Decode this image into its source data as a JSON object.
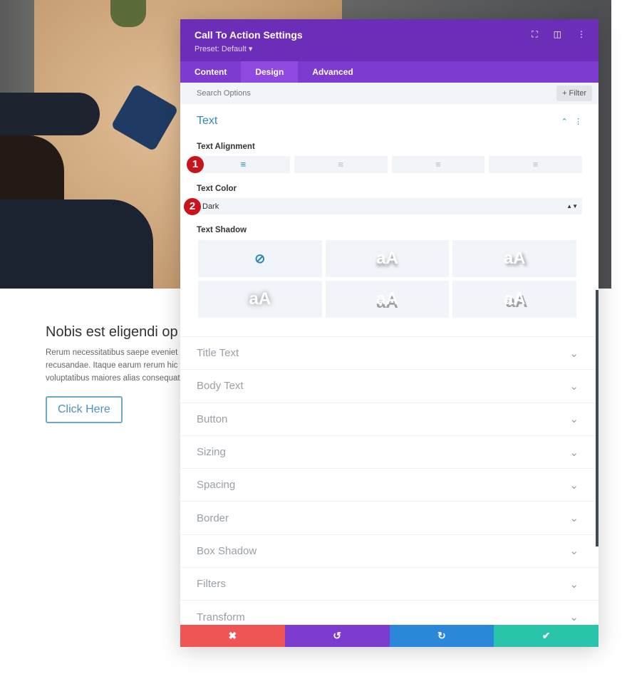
{
  "page": {
    "heading": "Nobis est eligendi op",
    "body_lines": [
      "Rerum necessitatibus saepe eveniet u",
      "recusandae. Itaque earum rerum hic t",
      "voluptatibus maiores alias consequatu"
    ],
    "button": "Click Here"
  },
  "panel": {
    "title": "Call To Action Settings",
    "preset": "Preset: Default ▾",
    "tabs": [
      "Content",
      "Design",
      "Advanced"
    ],
    "active_tab": "Design",
    "search_placeholder": "Search Options",
    "filter": "+ Filter",
    "section": {
      "title": "Text",
      "alignment_label": "Text Alignment",
      "color_label": "Text Color",
      "color_value": "Dark",
      "shadow_label": "Text Shadow",
      "shadow_preview": "aA"
    },
    "badges": [
      "1",
      "2"
    ],
    "groups": [
      "Title Text",
      "Body Text",
      "Button",
      "Sizing",
      "Spacing",
      "Border",
      "Box Shadow",
      "Filters",
      "Transform"
    ],
    "footer_colors": {
      "cancel": "#ef5555",
      "undo": "#7e3bd0",
      "redo": "#2b87da",
      "save": "#29c4a9"
    }
  }
}
